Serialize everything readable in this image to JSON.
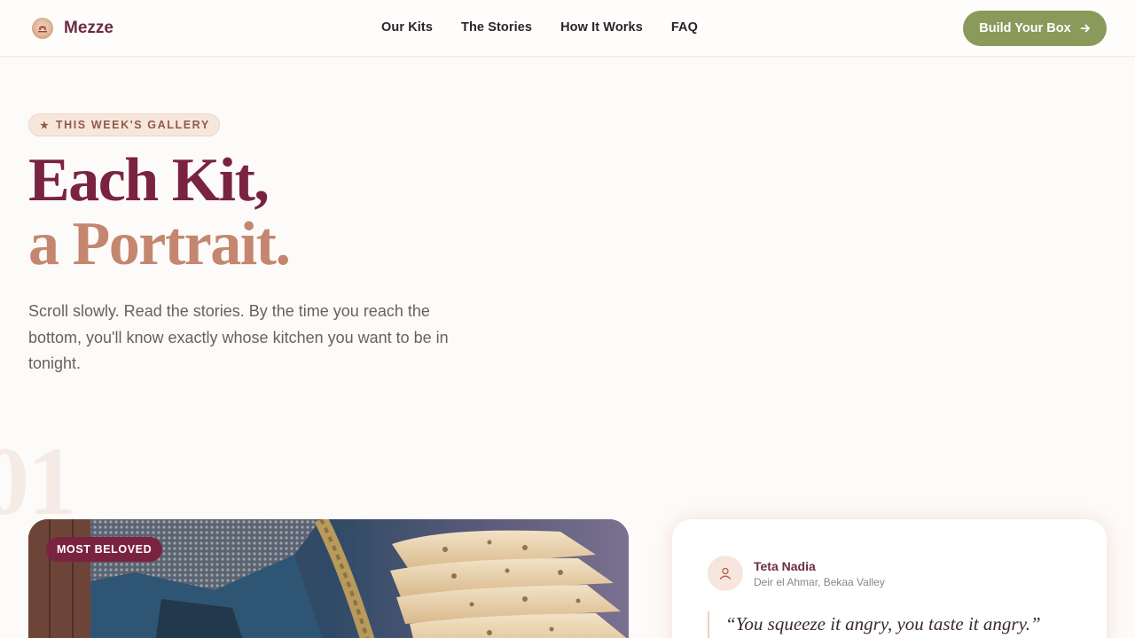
{
  "header": {
    "brand": "Mezze",
    "nav": [
      "Our Kits",
      "The Stories",
      "How It Works",
      "FAQ"
    ],
    "cta_label": "Build Your Box"
  },
  "hero": {
    "eyebrow": "THIS WEEK'S GALLERY",
    "headline_line1": "Each Kit,",
    "headline_line2": "a Portrait.",
    "lead": "Scroll slowly. Read the stories. By the time you reach the bottom, you'll know exactly whose kitchen you want to be in tonight."
  },
  "kit": {
    "number": "01",
    "badge": "MOST BELOVED",
    "author_name": "Teta Nadia",
    "author_place": "Deir el Ahmar, Bekaa Valley",
    "quote": "“You squeeze it angry, you taste it angry.”"
  },
  "colors": {
    "brand": "#6e2a45",
    "headline": "#7a2341",
    "accent": "#c4866e",
    "cta": "#8a9a5b",
    "background": "#fdfbf9"
  },
  "icons": {
    "logo": "brand-logo-icon",
    "cta": "arrow-right-icon",
    "eyebrow": "star-icon",
    "avatar": "user-icon"
  }
}
